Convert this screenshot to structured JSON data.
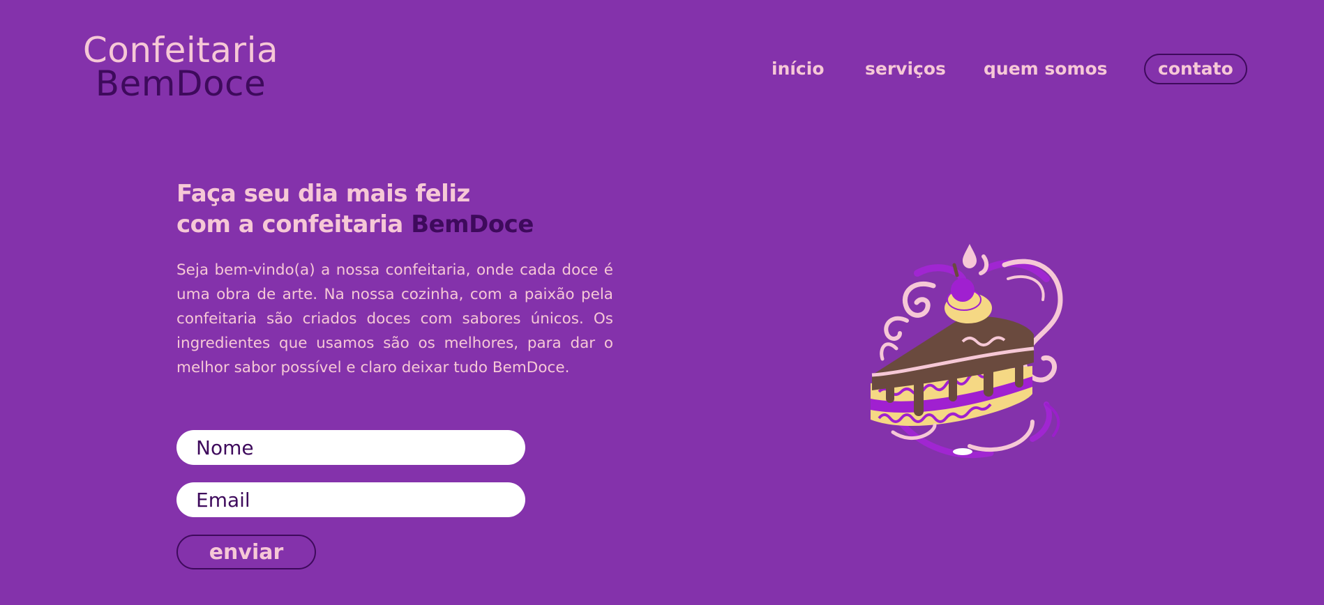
{
  "logo": {
    "line1": "Confeitaria",
    "line2": "BemDoce"
  },
  "nav": {
    "items": [
      {
        "label": "início"
      },
      {
        "label": "serviços"
      },
      {
        "label": "quem somos"
      },
      {
        "label": "contato"
      }
    ]
  },
  "hero": {
    "title_line1": "Faça seu dia mais feliz",
    "title_line2": "com a confeitaria ",
    "title_brand": "BemDoce",
    "text": "Seja bem-vindo(a) a nossa confeitaria, onde cada doce é uma obra de arte. Na nossa cozinha, com a paixão pela confeitaria são criados doces com sabores únicos. Os ingredientes que usamos são os melhores, para dar o melhor sabor possível e claro deixar tudo BemDoce."
  },
  "form": {
    "name_placeholder": "Nome",
    "name_value": "",
    "email_placeholder": "Email",
    "email_value": "",
    "submit_label": "enviar"
  },
  "illustration": {
    "icon": "cake-slice-illustration"
  },
  "colors": {
    "background": "#8432ab",
    "accent_pink": "#f6c8d6",
    "dark_purple": "#3e0a5c",
    "field_bg": "#ffffff"
  }
}
